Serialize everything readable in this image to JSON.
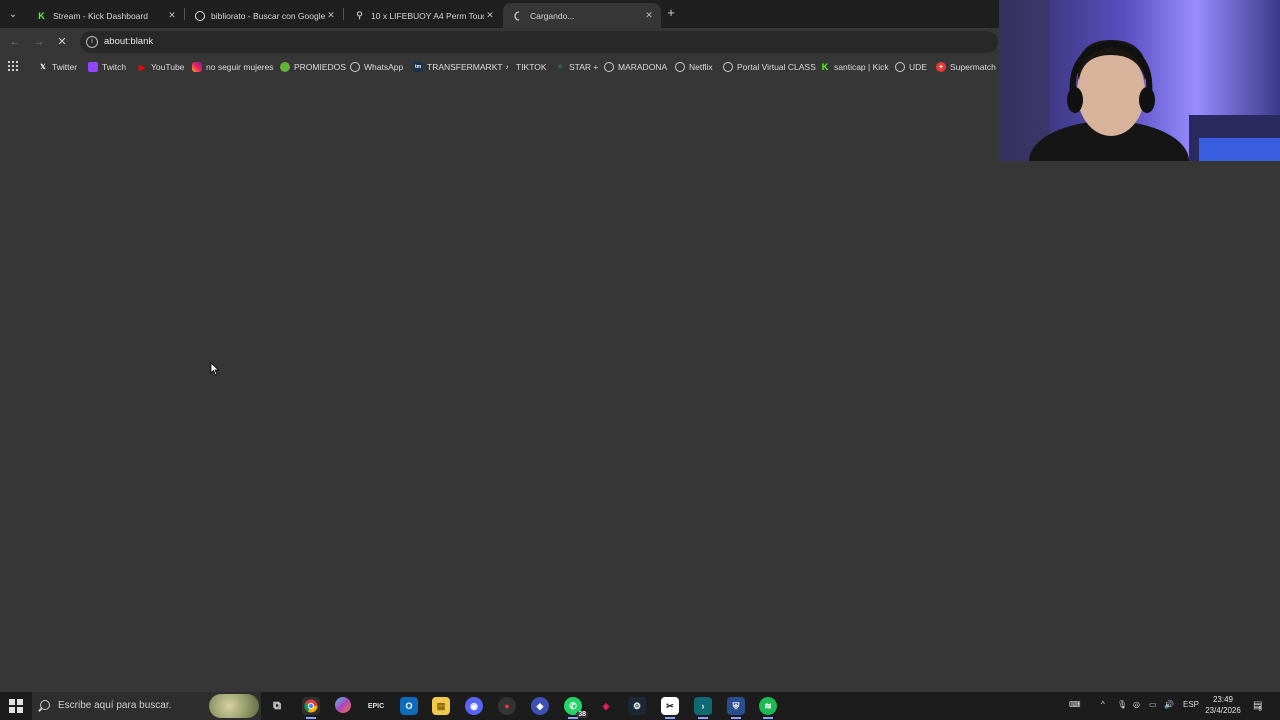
{
  "browser": {
    "tabs": [
      {
        "title": "Stream - Kick Dashboard",
        "favicon": "kick-icon",
        "active": false
      },
      {
        "title": "bibliorato - Buscar con Google",
        "favicon": "google-icon",
        "active": false
      },
      {
        "title": "10 x LIFEBUOY A4 Perm Touch Pe",
        "favicon": "link-icon",
        "active": false
      },
      {
        "title": "Cargando...",
        "favicon": "loading-spinner-icon",
        "active": true
      }
    ],
    "address": "about:blank",
    "bookmarks": [
      {
        "label": "Twitter",
        "icon": "x-icon"
      },
      {
        "label": "Twitch",
        "icon": "twitch-icon"
      },
      {
        "label": "YouTube",
        "icon": "youtube-icon"
      },
      {
        "label": "no seguir mujeres",
        "icon": "instagram-icon"
      },
      {
        "label": "PROMIEDOS",
        "icon": "promiedos-icon"
      },
      {
        "label": "WhatsApp",
        "icon": "globe-icon"
      },
      {
        "label": "TRANSFERMARKT",
        "icon": "transfermarkt-icon"
      },
      {
        "label": "TIKTOK",
        "icon": "tiktok-icon"
      },
      {
        "label": "STAR +",
        "icon": "star-plus-icon"
      },
      {
        "label": "MARADONA",
        "icon": "globe-icon"
      },
      {
        "label": "Netflix",
        "icon": "globe-icon"
      },
      {
        "label": "Portal Virtual CLASS",
        "icon": "globe-icon"
      },
      {
        "label": "santicap | Kick",
        "icon": "kick-icon"
      },
      {
        "label": "UDE",
        "icon": "globe-icon"
      },
      {
        "label": "Supermatch",
        "icon": "supermatch-icon"
      }
    ]
  },
  "taskbar": {
    "search_placeholder": "Escribe aquí para buscar.",
    "whatsapp_badge": "38",
    "language": "ESP",
    "time": "23:49",
    "date": "23/4/2026",
    "notifications": "5"
  },
  "colors": {
    "kick": "#53fc18",
    "page_bg": "#363636",
    "tab_bg": "#1f1f1f",
    "taskbar_bg": "#1c1c1c"
  }
}
